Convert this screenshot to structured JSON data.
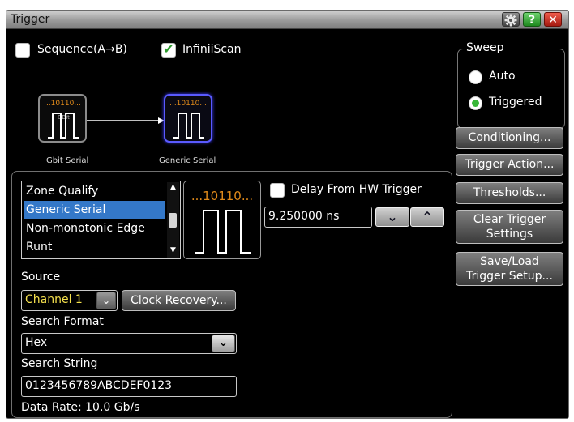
{
  "window": {
    "title": "Trigger"
  },
  "options": {
    "sequence_label": "Sequence(A→B)",
    "sequence_checked": false,
    "infiniiscan_label": "InfiniiScan",
    "infiniiscan_checked": true
  },
  "diagram": {
    "node1_bits": "...10110...",
    "node1_sub": "GBit",
    "node1_label": "Gbit Serial",
    "node2_bits": "...10110...",
    "node2_label": "Generic Serial"
  },
  "trigger_types": [
    "Zone Qualify",
    "Generic Serial",
    "Non-monotonic Edge",
    "Runt"
  ],
  "selected_type": "Generic Serial",
  "signal_preview": {
    "bits": "...10110..."
  },
  "delay": {
    "label": "Delay From HW Trigger",
    "checked": false,
    "value": "9.250000 ns"
  },
  "source": {
    "label": "Source",
    "value": "Channel 1",
    "clock_recovery_label": "Clock Recovery..."
  },
  "search_format": {
    "label": "Search Format",
    "value": "Hex"
  },
  "search_string": {
    "label": "Search String",
    "value": "0123456789ABCDEF0123"
  },
  "data_rate": "Data Rate: 10.0 Gb/s",
  "sweep": {
    "title": "Sweep",
    "options": [
      "Auto",
      "Triggered"
    ],
    "selected": "Triggered"
  },
  "side_buttons": {
    "conditioning": "Conditioning...",
    "trigger_action": "Trigger Action...",
    "thresholds": "Thresholds...",
    "clear_line1": "Clear Trigger",
    "clear_line2": "Settings",
    "save_line1": "Save/Load",
    "save_line2": "Trigger Setup..."
  },
  "colors": {
    "selection": "#3478c8",
    "channel_text": "#f4e04d",
    "bits_orange": "#e08a1a",
    "radio_on": "#37b737",
    "node_active_border": "#5a5aff"
  },
  "icons": {
    "gear": "gear-icon",
    "help": "help-icon",
    "close": "close-icon"
  }
}
